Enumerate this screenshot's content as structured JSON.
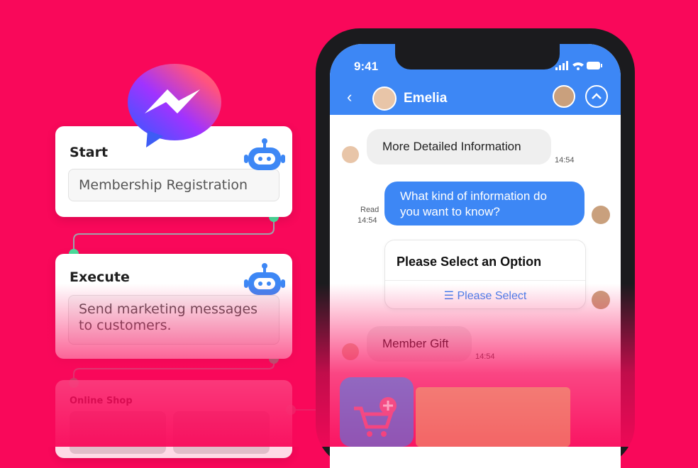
{
  "flow": {
    "start": {
      "title": "Start",
      "value": "Membership Registration"
    },
    "execute": {
      "title": "Execute",
      "value_line1": "Send marketing messages",
      "value_line2": "to customers."
    },
    "shop": {
      "title": "Online Shop"
    }
  },
  "icons": {
    "logo": "messenger-logo",
    "bot": "robot-icon",
    "cart": "cart-plus-icon",
    "list": "list-icon"
  },
  "colors": {
    "background": "#f9085a",
    "accent": "#3d87f5",
    "connector": "#4cdd9c"
  },
  "phone": {
    "time": "9:41",
    "contact_name": "Emelia",
    "messages": {
      "m1": {
        "text": "More Detailed Information",
        "time": "14:54"
      },
      "m2": {
        "line1": "What kind of information do",
        "line2": "you want to know?",
        "read": "Read",
        "time": "14:54"
      },
      "option": {
        "title": "Please Select an Option",
        "link": "Please Select"
      },
      "m3": {
        "text": "Member Gift",
        "time": "14:54"
      }
    }
  }
}
